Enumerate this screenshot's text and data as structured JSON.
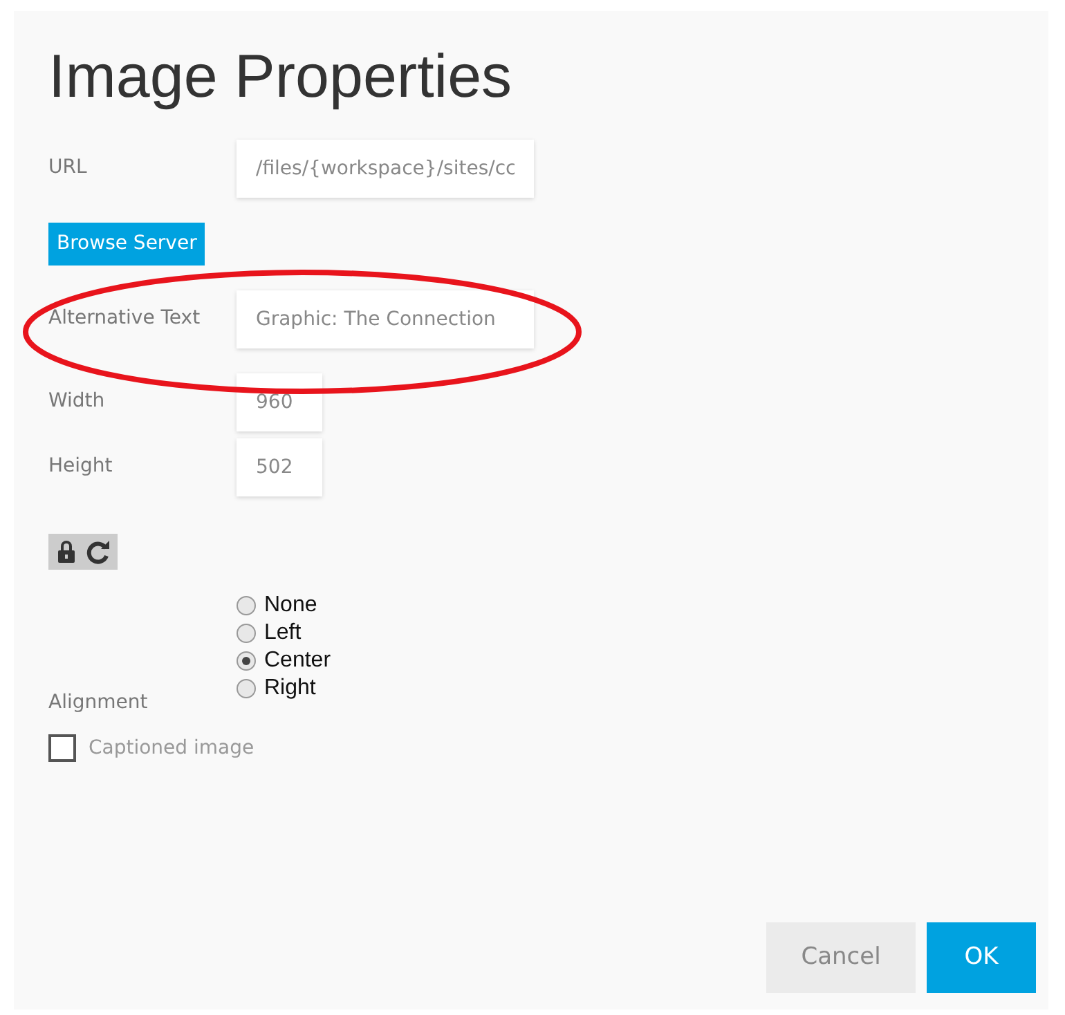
{
  "dialog": {
    "title": "Image Properties"
  },
  "fields": [
    {
      "label": "URL",
      "value": "/files/{workspace}/sites/cc",
      "kind": "wide"
    },
    {
      "label": "Alternative Text",
      "value": "Graphic: The Connection",
      "kind": "wide"
    },
    {
      "label": "Width",
      "value": "960",
      "kind": "narrow"
    },
    {
      "label": "Height",
      "value": "502",
      "kind": "narrow"
    }
  ],
  "browse_button": "Browse Server",
  "alignment": {
    "label": "Alignment",
    "options": [
      {
        "label": "None",
        "selected": false
      },
      {
        "label": "Left",
        "selected": false
      },
      {
        "label": "Center",
        "selected": true
      },
      {
        "label": "Right",
        "selected": false
      }
    ]
  },
  "captioned": {
    "label": "Captioned image",
    "checked": false
  },
  "buttons": [
    {
      "label": "Cancel",
      "kind": "secondary"
    },
    {
      "label": "OK",
      "kind": "primary"
    }
  ],
  "annotation": {
    "color": "#e8141c"
  }
}
